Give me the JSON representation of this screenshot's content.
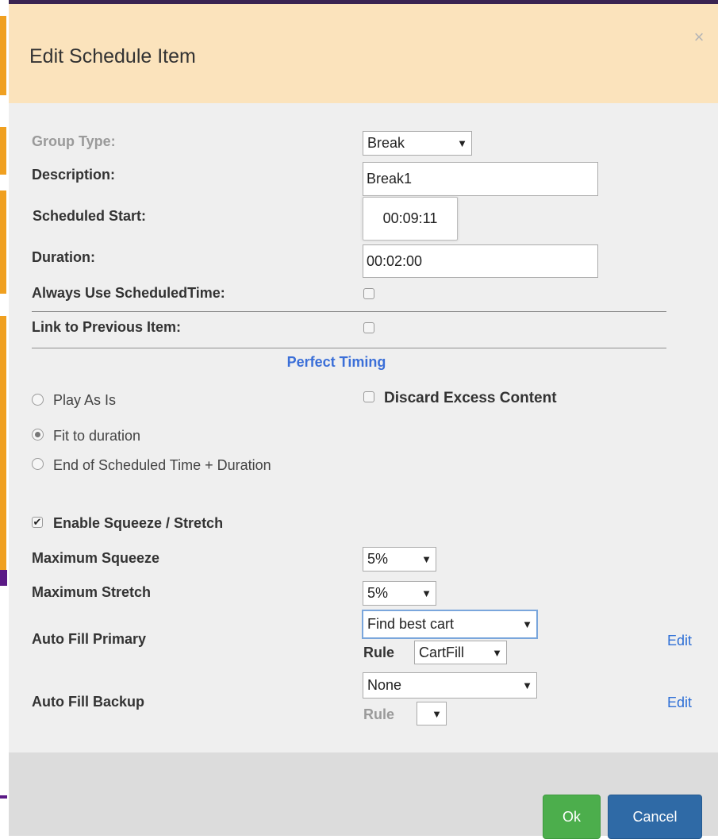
{
  "dialog": {
    "title": "Edit Schedule Item",
    "close_label": "×"
  },
  "form": {
    "group_type": {
      "label": "Group Type:",
      "value": "Break"
    },
    "description": {
      "label": "Description:",
      "value": "Break1"
    },
    "scheduled_start": {
      "label": "Scheduled Start:",
      "value": "00:09:11"
    },
    "duration": {
      "label": "Duration:",
      "value": "00:02:00"
    },
    "always_use_scheduled_time": {
      "label": "Always Use ScheduledTime:",
      "checked": false
    },
    "link_to_previous": {
      "label": "Link to Previous Item:",
      "checked": false
    }
  },
  "perfect_timing": {
    "title": "Perfect Timing",
    "options": [
      {
        "label": "Play As Is",
        "selected": false
      },
      {
        "label": "Fit to duration",
        "selected": true
      },
      {
        "label": "End of Scheduled Time + Duration",
        "selected": false
      }
    ],
    "discard_excess": {
      "label": "Discard Excess Content",
      "checked": false
    }
  },
  "squeeze": {
    "enable": {
      "label": "Enable Squeeze / Stretch",
      "checked": true,
      "mark": "✔"
    },
    "max_squeeze": {
      "label": "Maximum Squeeze",
      "value": "5%"
    },
    "max_stretch": {
      "label": "Maximum Stretch",
      "value": "5%"
    }
  },
  "auto_fill": {
    "primary": {
      "label": "Auto Fill Primary",
      "value": "Find best cart",
      "rule_label": "Rule",
      "rule_value": "CartFill",
      "edit_label": "Edit"
    },
    "backup": {
      "label": "Auto Fill Backup",
      "value": "None",
      "rule_label": "Rule",
      "rule_value": "",
      "edit_label": "Edit"
    }
  },
  "footer": {
    "ok_label": "Ok",
    "cancel_label": "Cancel"
  },
  "colors": {
    "header_bg": "#fbe3bc",
    "body_bg": "#efefef",
    "footer_bg": "#dcdcdc",
    "accent_blue": "#3b6fd8",
    "ok_green": "#4cae4c",
    "cancel_blue": "#2f6aa6"
  }
}
